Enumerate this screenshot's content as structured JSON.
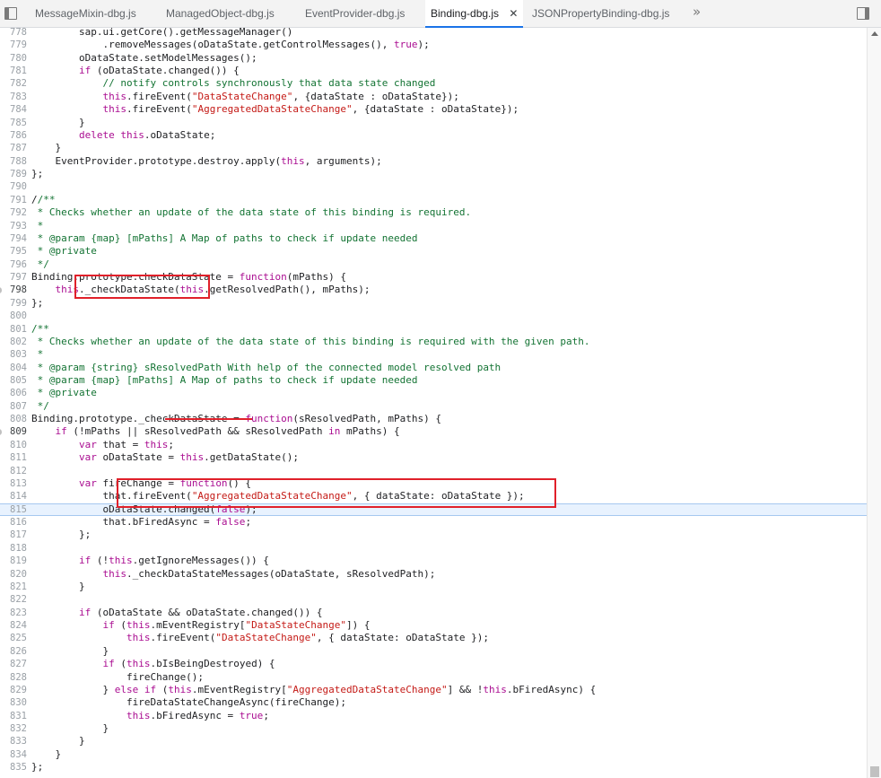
{
  "tabs": [
    {
      "label": "MessageMixin-dbg.js",
      "active": false
    },
    {
      "label": "ManagedObject-dbg.js",
      "active": false
    },
    {
      "label": "EventProvider-dbg.js",
      "active": false
    },
    {
      "label": "Binding-dbg.js",
      "active": true,
      "close": "✕"
    },
    {
      "label": "JSONPropertyBinding-dbg.js",
      "active": false
    }
  ],
  "tab_overflow": "»",
  "current_line": "815",
  "breakpoint_lines": [
    "798",
    "809"
  ],
  "lines": [
    {
      "n": "778",
      "segs": [
        [
          "",
          "        sap.ui.getCore().getMessageManager()"
        ]
      ]
    },
    {
      "n": "779",
      "segs": [
        [
          "",
          "            .removeMessages(oDataState.getControlMessages(), "
        ],
        [
          "kw",
          "true"
        ],
        [
          "",
          ");"
        ]
      ]
    },
    {
      "n": "780",
      "segs": [
        [
          "",
          "        oDataState.setModelMessages();"
        ]
      ]
    },
    {
      "n": "781",
      "segs": [
        [
          "",
          "        "
        ],
        [
          "kw",
          "if"
        ],
        [
          "",
          " (oDataState.changed()) {"
        ]
      ]
    },
    {
      "n": "782",
      "segs": [
        [
          "",
          "            "
        ],
        [
          "cmt",
          "// notify controls synchronously that data state changed"
        ]
      ]
    },
    {
      "n": "783",
      "segs": [
        [
          "",
          "            "
        ],
        [
          "kw",
          "this"
        ],
        [
          "",
          ".fireEvent("
        ],
        [
          "str",
          "\"DataStateChange\""
        ],
        [
          "",
          ", {dataState : oDataState});"
        ]
      ]
    },
    {
      "n": "784",
      "segs": [
        [
          "",
          "            "
        ],
        [
          "kw",
          "this"
        ],
        [
          "",
          ".fireEvent("
        ],
        [
          "str",
          "\"AggregatedDataStateChange\""
        ],
        [
          "",
          ", {dataState : oDataState});"
        ]
      ]
    },
    {
      "n": "785",
      "segs": [
        [
          "",
          "        }"
        ]
      ]
    },
    {
      "n": "786",
      "segs": [
        [
          "",
          "        "
        ],
        [
          "kw",
          "delete"
        ],
        [
          "",
          " "
        ],
        [
          "kw",
          "this"
        ],
        [
          "",
          ".oDataState;"
        ]
      ]
    },
    {
      "n": "787",
      "segs": [
        [
          "",
          "    }"
        ]
      ]
    },
    {
      "n": "788",
      "segs": [
        [
          "",
          "    EventProvider.prototype.destroy.apply("
        ],
        [
          "kw",
          "this"
        ],
        [
          "",
          ", arguments);"
        ]
      ]
    },
    {
      "n": "789",
      "segs": [
        [
          "",
          "};"
        ]
      ]
    },
    {
      "n": "790",
      "segs": [
        [
          "",
          ""
        ]
      ]
    },
    {
      "n": "791",
      "segs": [
        [
          "",
          "/"
        ],
        [
          "cmt",
          "/**"
        ]
      ]
    },
    {
      "n": "792",
      "segs": [
        [
          "cmt",
          " * Checks whether an update of the data state of this binding is required."
        ]
      ]
    },
    {
      "n": "793",
      "segs": [
        [
          "cmt",
          " *"
        ]
      ]
    },
    {
      "n": "794",
      "segs": [
        [
          "cmt",
          " * @param {map} [mPaths] A Map of paths to check if update needed"
        ]
      ]
    },
    {
      "n": "795",
      "segs": [
        [
          "cmt",
          " * @private"
        ]
      ]
    },
    {
      "n": "796",
      "segs": [
        [
          "cmt",
          " */"
        ]
      ]
    },
    {
      "n": "797",
      "segs": [
        [
          "",
          "Binding.prototype.checkDataState = "
        ],
        [
          "kw",
          "function"
        ],
        [
          "",
          "(mPaths) {"
        ]
      ]
    },
    {
      "n": "798",
      "segs": [
        [
          "",
          "    "
        ],
        [
          "kw",
          "this"
        ],
        [
          "",
          "._checkDataState("
        ],
        [
          "kw",
          "this"
        ],
        [
          "",
          ".getResolvedPath(), mPaths);"
        ]
      ]
    },
    {
      "n": "799",
      "segs": [
        [
          "",
          "};"
        ]
      ]
    },
    {
      "n": "800",
      "segs": [
        [
          "",
          ""
        ]
      ]
    },
    {
      "n": "801",
      "segs": [
        [
          "cmt",
          "/**"
        ]
      ]
    },
    {
      "n": "802",
      "segs": [
        [
          "cmt",
          " * Checks whether an update of the data state of this binding is required with the given path."
        ]
      ]
    },
    {
      "n": "803",
      "segs": [
        [
          "cmt",
          " *"
        ]
      ]
    },
    {
      "n": "804",
      "segs": [
        [
          "cmt",
          " * @param {string} sResolvedPath With help of the connected model resolved path"
        ]
      ]
    },
    {
      "n": "805",
      "segs": [
        [
          "cmt",
          " * @param {map} [mPaths] A Map of paths to check if update needed"
        ]
      ]
    },
    {
      "n": "806",
      "segs": [
        [
          "cmt",
          " * @private"
        ]
      ]
    },
    {
      "n": "807",
      "segs": [
        [
          "cmt",
          " */"
        ]
      ]
    },
    {
      "n": "808",
      "segs": [
        [
          "",
          "Binding.prototype._checkDataState = "
        ],
        [
          "kw",
          "function"
        ],
        [
          "",
          "(sResolvedPath, mPaths) {"
        ]
      ]
    },
    {
      "n": "809",
      "segs": [
        [
          "",
          "    "
        ],
        [
          "kw",
          "if"
        ],
        [
          "",
          " (!mPaths || sResolvedPath && sResolvedPath "
        ],
        [
          "kw",
          "in"
        ],
        [
          "",
          " mPaths) {"
        ]
      ]
    },
    {
      "n": "810",
      "segs": [
        [
          "",
          "        "
        ],
        [
          "kw",
          "var"
        ],
        [
          "",
          " that = "
        ],
        [
          "kw",
          "this"
        ],
        [
          "",
          ";"
        ]
      ]
    },
    {
      "n": "811",
      "segs": [
        [
          "",
          "        "
        ],
        [
          "kw",
          "var"
        ],
        [
          "",
          " oDataState = "
        ],
        [
          "kw",
          "this"
        ],
        [
          "",
          ".getDataState();"
        ]
      ]
    },
    {
      "n": "812",
      "segs": [
        [
          "",
          ""
        ]
      ]
    },
    {
      "n": "813",
      "segs": [
        [
          "",
          "        "
        ],
        [
          "kw",
          "var"
        ],
        [
          "",
          " fireChange = "
        ],
        [
          "kw",
          "function"
        ],
        [
          "",
          "() {"
        ]
      ]
    },
    {
      "n": "814",
      "segs": [
        [
          "",
          "            that.fireEvent("
        ],
        [
          "str",
          "\"AggregatedDataStateChange\""
        ],
        [
          "",
          ", { dataState: oDataState });"
        ]
      ]
    },
    {
      "n": "815",
      "segs": [
        [
          "",
          "            oDataState.changed("
        ],
        [
          "kw",
          "false"
        ],
        [
          "",
          ");"
        ]
      ]
    },
    {
      "n": "816",
      "segs": [
        [
          "",
          "            that.bFiredAsync = "
        ],
        [
          "kw",
          "false"
        ],
        [
          "",
          ";"
        ]
      ]
    },
    {
      "n": "817",
      "segs": [
        [
          "",
          "        };"
        ]
      ]
    },
    {
      "n": "818",
      "segs": [
        [
          "",
          ""
        ]
      ]
    },
    {
      "n": "819",
      "segs": [
        [
          "",
          "        "
        ],
        [
          "kw",
          "if"
        ],
        [
          "",
          " (!"
        ],
        [
          "kw",
          "this"
        ],
        [
          "",
          ".getIgnoreMessages()) {"
        ]
      ]
    },
    {
      "n": "820",
      "segs": [
        [
          "",
          "            "
        ],
        [
          "kw",
          "this"
        ],
        [
          "",
          "._checkDataStateMessages(oDataState, sResolvedPath);"
        ]
      ]
    },
    {
      "n": "821",
      "segs": [
        [
          "",
          "        }"
        ]
      ]
    },
    {
      "n": "822",
      "segs": [
        [
          "",
          ""
        ]
      ]
    },
    {
      "n": "823",
      "segs": [
        [
          "",
          "        "
        ],
        [
          "kw",
          "if"
        ],
        [
          "",
          " (oDataState && oDataState.changed()) {"
        ]
      ]
    },
    {
      "n": "824",
      "segs": [
        [
          "",
          "            "
        ],
        [
          "kw",
          "if"
        ],
        [
          "",
          " ("
        ],
        [
          "kw",
          "this"
        ],
        [
          "",
          ".mEventRegistry["
        ],
        [
          "str",
          "\"DataStateChange\""
        ],
        [
          "",
          "]) {"
        ]
      ]
    },
    {
      "n": "825",
      "segs": [
        [
          "",
          "                "
        ],
        [
          "kw",
          "this"
        ],
        [
          "",
          ".fireEvent("
        ],
        [
          "str",
          "\"DataStateChange\""
        ],
        [
          "",
          ", { dataState: oDataState });"
        ]
      ]
    },
    {
      "n": "826",
      "segs": [
        [
          "",
          "            }"
        ]
      ]
    },
    {
      "n": "827",
      "segs": [
        [
          "",
          "            "
        ],
        [
          "kw",
          "if"
        ],
        [
          "",
          " ("
        ],
        [
          "kw",
          "this"
        ],
        [
          "",
          ".bIsBeingDestroyed) {"
        ]
      ]
    },
    {
      "n": "828",
      "segs": [
        [
          "",
          "                fireChange();"
        ]
      ]
    },
    {
      "n": "829",
      "segs": [
        [
          "",
          "            } "
        ],
        [
          "kw",
          "else if"
        ],
        [
          "",
          " ("
        ],
        [
          "kw",
          "this"
        ],
        [
          "",
          ".mEventRegistry["
        ],
        [
          "str",
          "\"AggregatedDataStateChange\""
        ],
        [
          "",
          "] && !"
        ],
        [
          "kw",
          "this"
        ],
        [
          "",
          ".bFiredAsync) {"
        ]
      ]
    },
    {
      "n": "830",
      "segs": [
        [
          "",
          "                fireDataStateChangeAsync(fireChange);"
        ]
      ]
    },
    {
      "n": "831",
      "segs": [
        [
          "",
          "                "
        ],
        [
          "kw",
          "this"
        ],
        [
          "",
          ".bFiredAsync = "
        ],
        [
          "kw",
          "true"
        ],
        [
          "",
          ";"
        ]
      ]
    },
    {
      "n": "832",
      "segs": [
        [
          "",
          "            }"
        ]
      ]
    },
    {
      "n": "833",
      "segs": [
        [
          "",
          "        }"
        ]
      ]
    },
    {
      "n": "834",
      "segs": [
        [
          "",
          "    }"
        ]
      ]
    },
    {
      "n": "835",
      "segs": [
        [
          "",
          "};"
        ]
      ]
    }
  ]
}
